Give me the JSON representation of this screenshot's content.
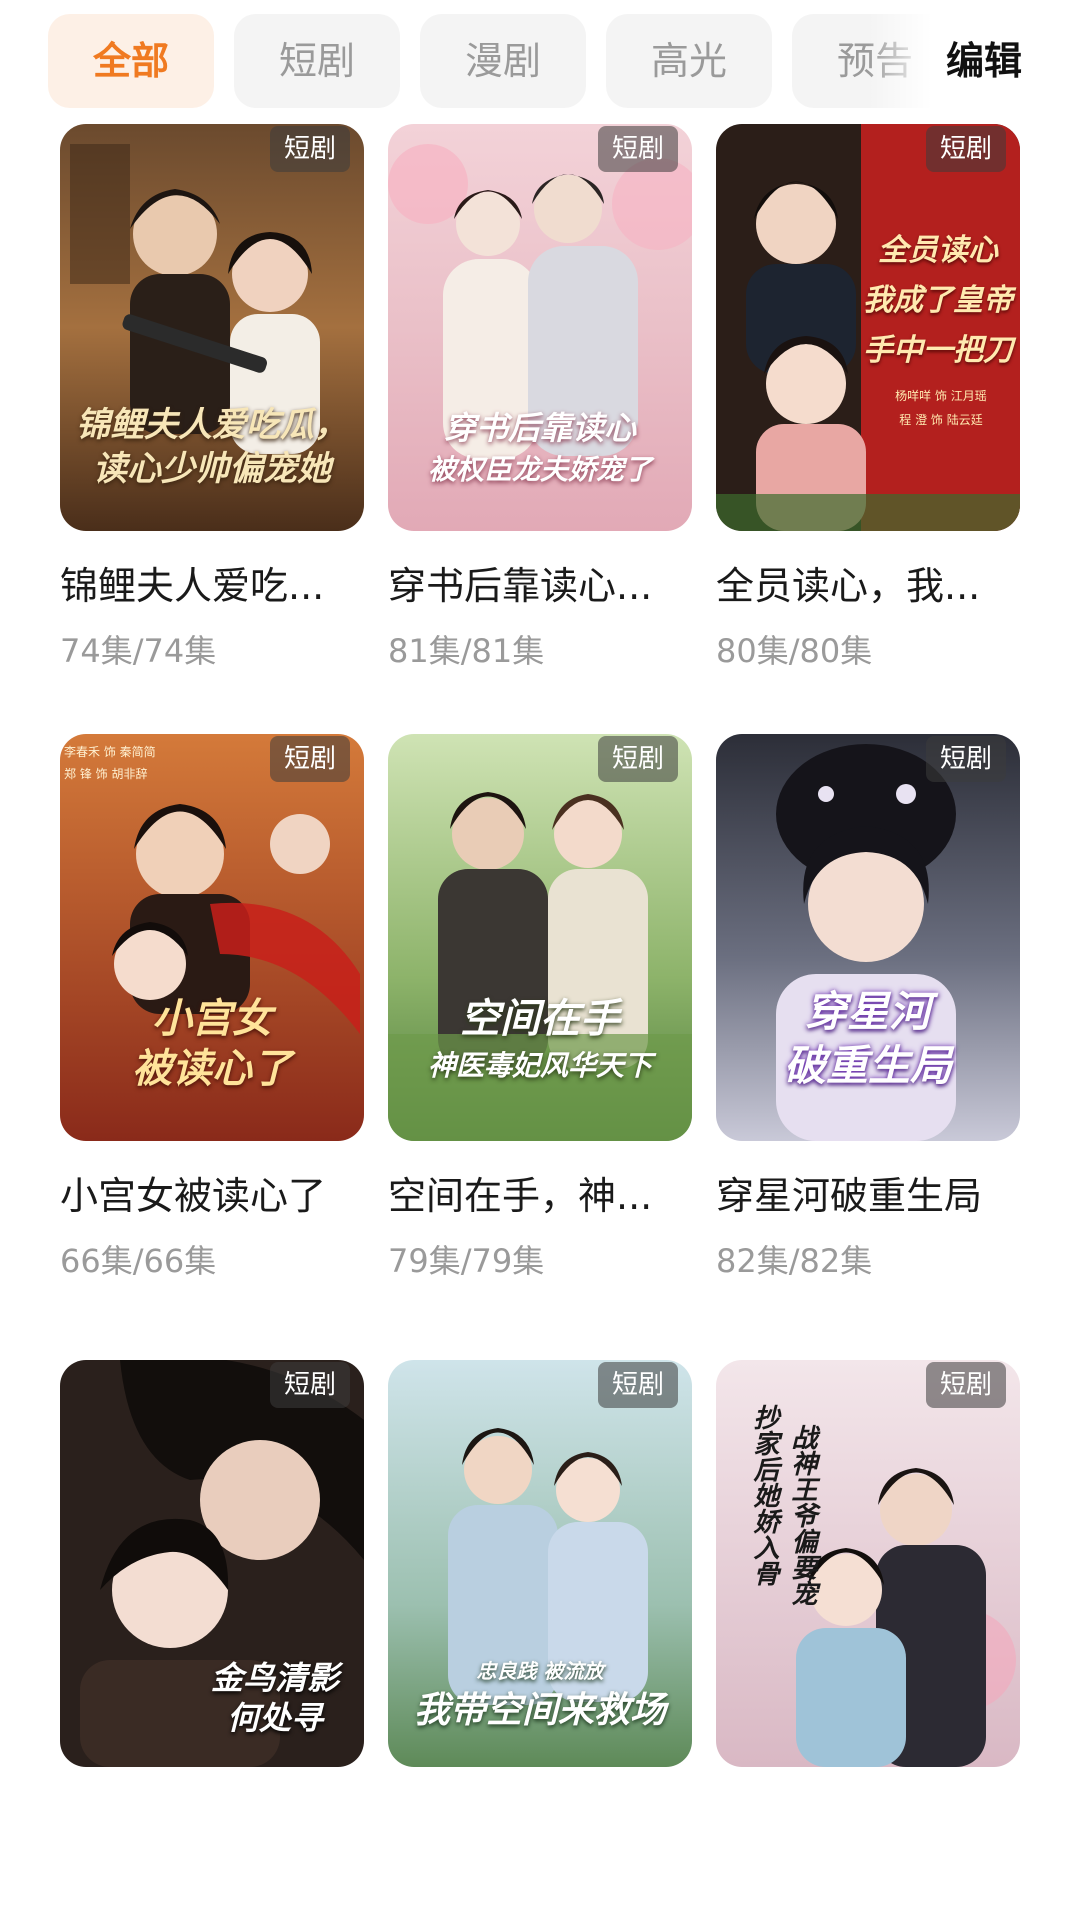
{
  "tabs": [
    {
      "label": "全部",
      "active": true
    },
    {
      "label": "短剧",
      "active": false
    },
    {
      "label": "漫剧",
      "active": false
    },
    {
      "label": "高光",
      "active": false
    },
    {
      "label": "预告",
      "active": false
    }
  ],
  "edit_label": "编辑",
  "accent_color": "#f07a21",
  "items": [
    {
      "tag": "短剧",
      "title": "锦鲤夫人爱吃...",
      "count": "74集/74集",
      "poster_text": [
        "锦鲤夫人爱吃瓜，",
        "读心少帅偏宠她"
      ]
    },
    {
      "tag": "短剧",
      "title": "穿书后靠读心...",
      "count": "81集/81集",
      "poster_text": [
        "穿书后靠读心",
        "被权臣龙夫娇宠了"
      ]
    },
    {
      "tag": "短剧",
      "title": "全员读心，我...",
      "count": "80集/80集",
      "poster_text": [
        "全员读心",
        "我成了皇帝",
        "手中一把刀"
      ],
      "poster_credits": [
        "杨咩咩 饰 江月瑶",
        "程 澄 饰 陆云廷"
      ]
    },
    {
      "tag": "短剧",
      "title": "小宫女被读心了",
      "count": "66集/66集",
      "poster_text": [
        "小宫女",
        "被读心了"
      ],
      "poster_credits": [
        "李春禾 饰 秦简简",
        "郑 锋 饰 胡非辞"
      ]
    },
    {
      "tag": "短剧",
      "title": "空间在手，神...",
      "count": "79集/79集",
      "poster_text": [
        "空间在手",
        "神医毒妃风华天下"
      ]
    },
    {
      "tag": "短剧",
      "title": "穿星河破重生局",
      "count": "82集/82集",
      "poster_text": [
        "穿星河",
        "破重生局"
      ]
    },
    {
      "tag": "短剧",
      "title": "",
      "count": "",
      "poster_text": [
        "金鸟清影",
        "何处寻"
      ]
    },
    {
      "tag": "短剧",
      "title": "",
      "count": "",
      "poster_text": [
        "忠良践 被流放",
        "我带空间来救场"
      ]
    },
    {
      "tag": "短剧",
      "title": "",
      "count": "",
      "poster_text": [
        "抄家后她娇入骨",
        "战神王爷偏要宠"
      ]
    }
  ]
}
